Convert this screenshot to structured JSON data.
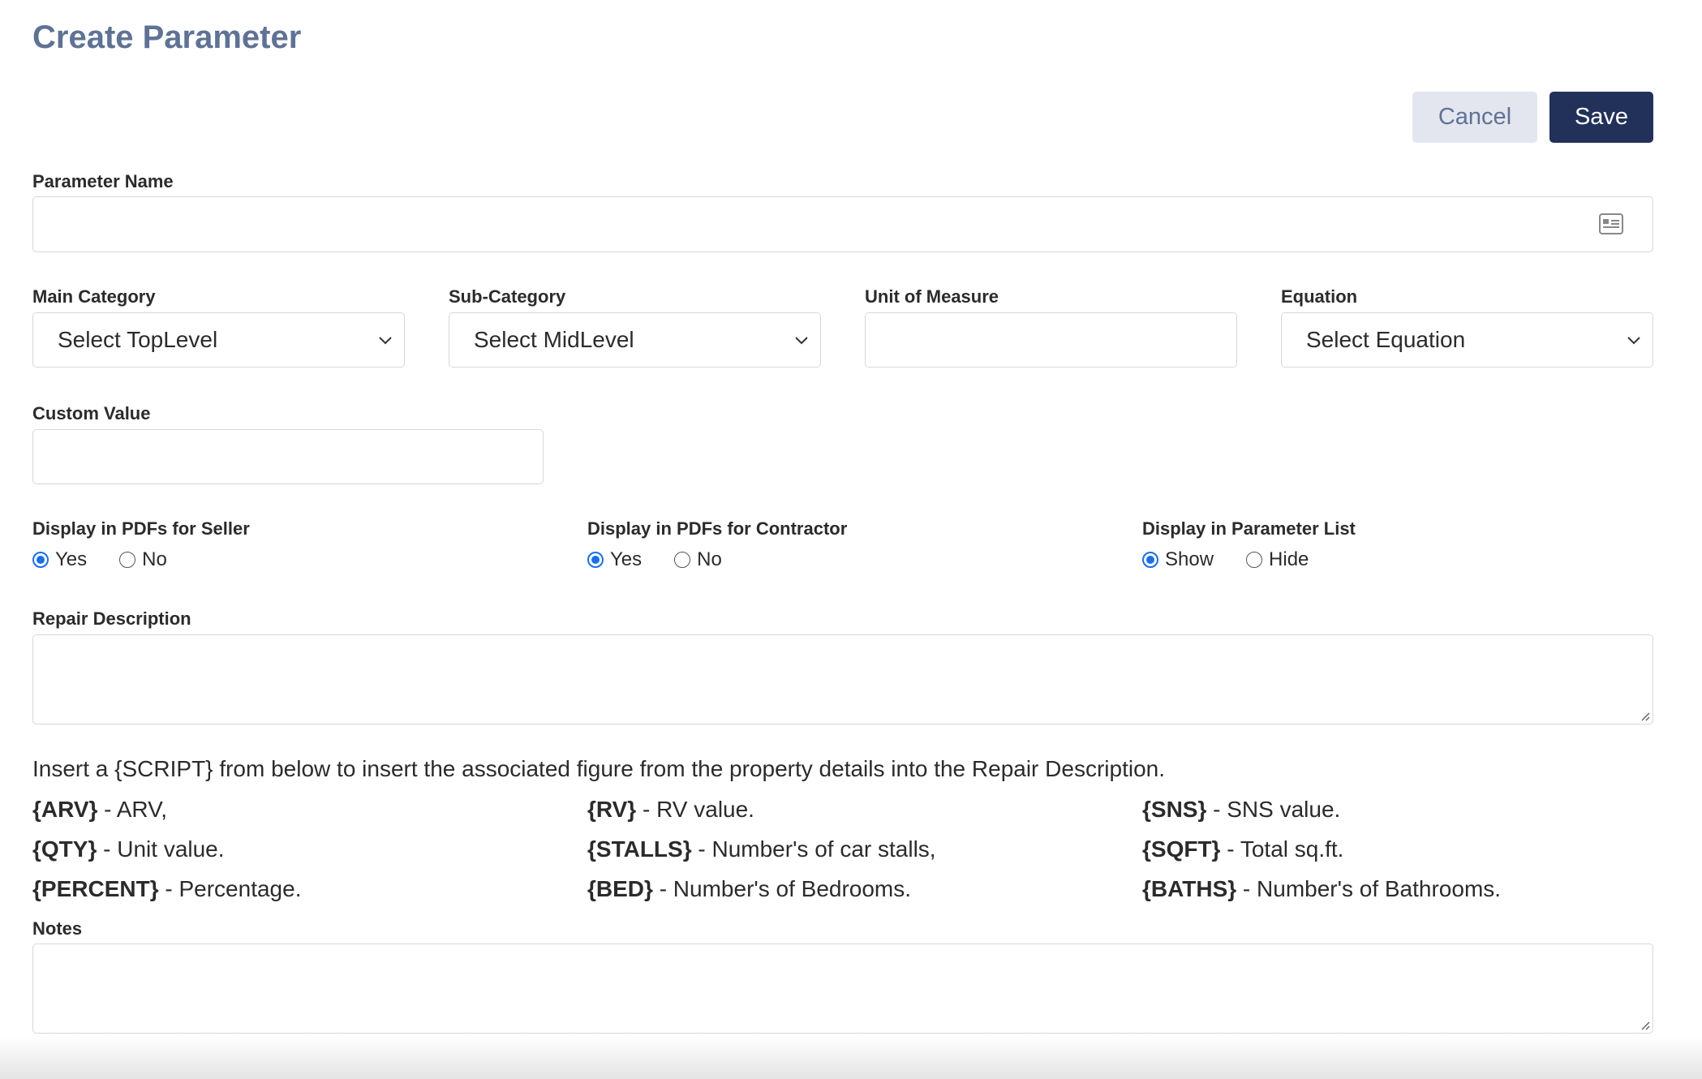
{
  "page": {
    "title": "Create Parameter"
  },
  "actions": {
    "cancel_label": "Cancel",
    "save_label": "Save"
  },
  "parameter_name": {
    "label": "Parameter Name",
    "value": ""
  },
  "main_category": {
    "label": "Main Category",
    "selected": "Select TopLevel"
  },
  "sub_category": {
    "label": "Sub-Category",
    "selected": "Select MidLevel"
  },
  "unit_of_measure": {
    "label": "Unit of Measure",
    "value": ""
  },
  "equation": {
    "label": "Equation",
    "selected": "Select Equation"
  },
  "custom_value": {
    "label": "Custom Value",
    "value": ""
  },
  "display_seller": {
    "label": "Display in PDFs for Seller",
    "options": [
      "Yes",
      "No"
    ],
    "selected": "Yes"
  },
  "display_contractor": {
    "label": "Display in PDFs for Contractor",
    "options": [
      "Yes",
      "No"
    ],
    "selected": "Yes"
  },
  "display_list": {
    "label": "Display in Parameter List",
    "options": [
      "Show",
      "Hide"
    ],
    "selected": "Show"
  },
  "repair_description": {
    "label": "Repair Description",
    "value": ""
  },
  "scripts": {
    "intro": "Insert a {SCRIPT} from below to insert the associated figure from the property details into the Repair Description.",
    "items": [
      {
        "key": "{ARV}",
        "desc": " - ARV,"
      },
      {
        "key": "{RV}",
        "desc": " - RV value."
      },
      {
        "key": "{SNS}",
        "desc": " - SNS value."
      },
      {
        "key": "{QTY}",
        "desc": " - Unit value."
      },
      {
        "key": "{STALLS}",
        "desc": " - Number's of car stalls,"
      },
      {
        "key": "{SQFT}",
        "desc": " - Total sq.ft."
      },
      {
        "key": "{PERCENT}",
        "desc": " - Percentage."
      },
      {
        "key": "{BED}",
        "desc": " - Number's of Bedrooms."
      },
      {
        "key": "{BATHS}",
        "desc": " - Number's of Bathrooms."
      }
    ]
  },
  "notes": {
    "label": "Notes",
    "value": ""
  },
  "colors": {
    "title": "#5f7295",
    "save_bg": "#22315a",
    "cancel_bg": "#e3e6ee",
    "radio_accent": "#1a6fe8"
  }
}
